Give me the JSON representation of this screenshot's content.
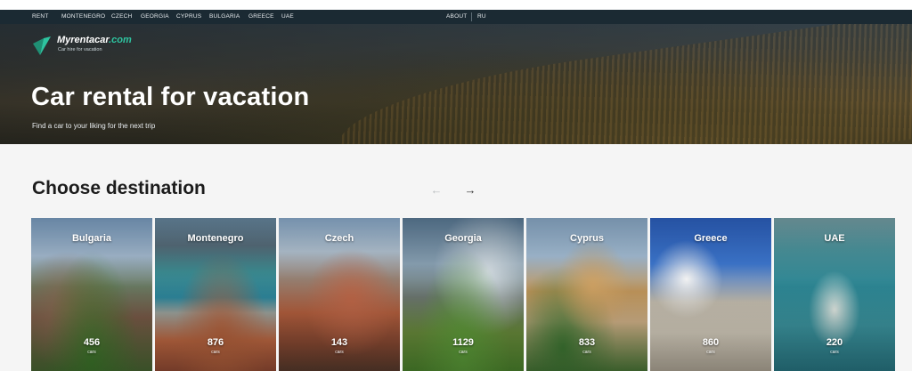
{
  "nav": {
    "left_items": [
      "RENT",
      "MONTENEGRO",
      "CZECH",
      "GEORGIA",
      "CYPRUS",
      "BULGARIA",
      "GREECE",
      "UAE"
    ],
    "about_label": "ABOUT",
    "lang_label": "RU"
  },
  "brand": {
    "name": "Myrentacar",
    "domain": ".com",
    "tagline": "Car hire for vacation",
    "icon": "paper-plane-logo-icon",
    "accent_color": "#2ec4a0"
  },
  "hero": {
    "title": "Car rental for vacation",
    "subtitle": "Find a car to your liking for the next trip"
  },
  "destinations": {
    "title": "Choose destination",
    "prev_icon": "arrow-left-icon",
    "next_icon": "arrow-right-icon",
    "items": [
      {
        "name": "Bulgaria",
        "count": "456",
        "unit": "cars"
      },
      {
        "name": "Montenegro",
        "count": "876",
        "unit": "cars"
      },
      {
        "name": "Czech",
        "count": "143",
        "unit": "cars"
      },
      {
        "name": "Georgia",
        "count": "1129",
        "unit": "cars"
      },
      {
        "name": "Cyprus",
        "count": "833",
        "unit": "cars"
      },
      {
        "name": "Greece",
        "count": "860",
        "unit": "cars"
      },
      {
        "name": "UAE",
        "count": "220",
        "unit": "cars"
      }
    ]
  }
}
